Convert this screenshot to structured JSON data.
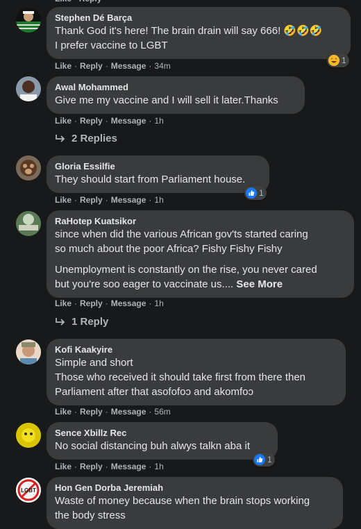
{
  "colors": {
    "background": "#18191a",
    "bubble": "#3a3b3c",
    "text": "#e4e6eb",
    "muted": "#b0b3b8",
    "like_blue": "#1877f2"
  },
  "actions": {
    "like": "Like",
    "reply": "Reply",
    "message": "Message",
    "dot": "·"
  },
  "comments": [
    {
      "author": "Stephen Dé Barça",
      "lines": [
        "Thank God it's here! The brain drain will say 666! 🤣🤣🤣",
        "I prefer vaccine to LGBT"
      ],
      "time": "34m",
      "reaction": {
        "icon": "laughing-emoji-icon",
        "count": "1"
      }
    },
    {
      "author": "Awal Mohammed",
      "lines": [
        "Give me my vaccine and I will sell it later.Thanks"
      ],
      "time": "1h",
      "replies": "2 Replies"
    },
    {
      "author": "Gloria Essilfie",
      "lines": [
        "They should start from Parliament house."
      ],
      "time": "1h",
      "reaction": {
        "icon": "like-icon",
        "count": "1"
      }
    },
    {
      "author": "RaHotep Kuatsikor",
      "lines": [
        "since when did the various African gov'ts started caring",
        "so much about the poor Africa? Fishy Fishy Fishy"
      ],
      "para2": [
        "Unemployment is constantly on the rise, you never cared",
        "but you're soo eager to vaccinate us.... "
      ],
      "see_more": "See More",
      "time": "1h",
      "replies": "1 Reply"
    },
    {
      "author": "Kofi Kaakyire",
      "lines": [
        "Simple and short",
        "Those who received it should take first from there then",
        "Parliament after that asofofoɔ and akomfoɔ"
      ],
      "time": "56m"
    },
    {
      "author": "Sence Xbillz Rec",
      "lines": [
        "No social distancing buh alwys talkn aba it"
      ],
      "time": "1h",
      "reaction": {
        "icon": "like-icon",
        "count": "1"
      }
    },
    {
      "author": "Hon Gen Dorba Jeremiah",
      "lines": [
        "Waste of money because when the brain stops working",
        "the body stress"
      ]
    }
  ],
  "avatar_labels": {
    "hon": "LGBT"
  }
}
